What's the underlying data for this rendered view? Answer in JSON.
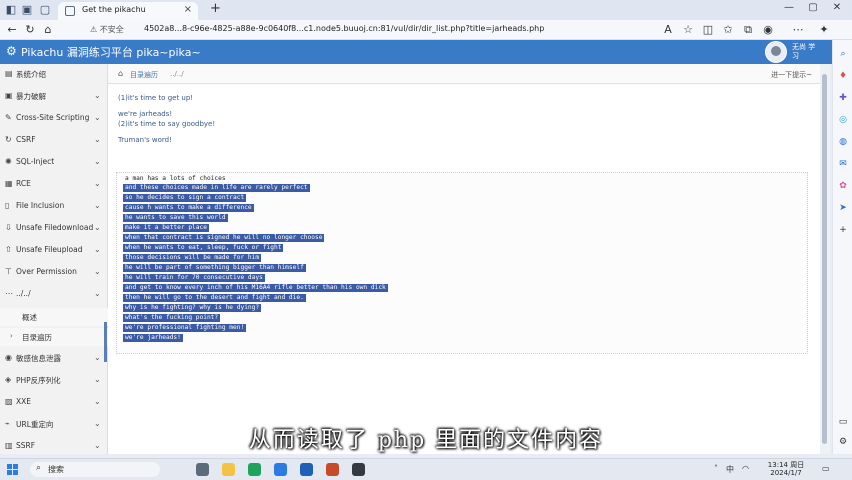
{
  "browser": {
    "tab_title": "Get the pikachu",
    "address_warning": "不安全",
    "url": "4502a8...8-c96e-4825-a88e-9c0640f8...c1.node5.buuoj.cn:81/vul/dir/dir_list.php?title=jarheads.php"
  },
  "app": {
    "title": "Pikachu 漏洞练习平台 pika~pika~",
    "user_label": "无尚 学习"
  },
  "sidebar": {
    "items": [
      {
        "label": "系统介绍"
      },
      {
        "label": "暴力破解"
      },
      {
        "label": "Cross-Site Scripting"
      },
      {
        "label": "CSRF"
      },
      {
        "label": "SQL-Inject"
      },
      {
        "label": "RCE"
      },
      {
        "label": "File Inclusion"
      },
      {
        "label": "Unsafe Filedownload"
      },
      {
        "label": "Unsafe Fileupload"
      },
      {
        "label": "Over Permission"
      },
      {
        "label": "../../"
      }
    ],
    "subitems": [
      {
        "label": "概述"
      },
      {
        "label": "目录遍历"
      }
    ],
    "items_after": [
      {
        "label": "敏感信息泄露"
      },
      {
        "label": "PHP反序列化"
      },
      {
        "label": "XXE"
      },
      {
        "label": "URL重定向"
      },
      {
        "label": "SSRF"
      }
    ]
  },
  "breadcrumb": {
    "home": "目录遍历",
    "current": "../../",
    "next": "进一下提示~"
  },
  "content": {
    "links": [
      "(1)it's time to get up!",
      "we're jarheads!",
      "(2)it's time to say goodbye!",
      "Truman's word!"
    ],
    "poem": [
      "a man has a lots of choices",
      "and these choices made in life are rarely perfect",
      "so he decides to sign a contract",
      "cause h wants to make a difference",
      "he wants to save this world",
      "make it a better place",
      "when that contract is signed he will no longer choose",
      "when he wants to eat, sleep, fuck or fight",
      "those decisions will be made for him",
      "he will be part of something bigger than himself",
      "he will train for 70 consecutive days",
      "and get to know every inch of his M16A4 rifle better than his own dick",
      "then he will go to the desert and fight and die.",
      "why is he fighting? why is he dying?",
      "what's the fucking point?",
      "we're professional fighting men!",
      "we're jarheads!"
    ]
  },
  "subtitle": "从而读取了 php 里面的文件内容",
  "taskbar": {
    "search_placeholder": "搜索",
    "time": "13:14 周日",
    "date": "2024/1/7"
  },
  "colors": {
    "header": "#3a7bc8",
    "selection": "#3b5ba5"
  }
}
